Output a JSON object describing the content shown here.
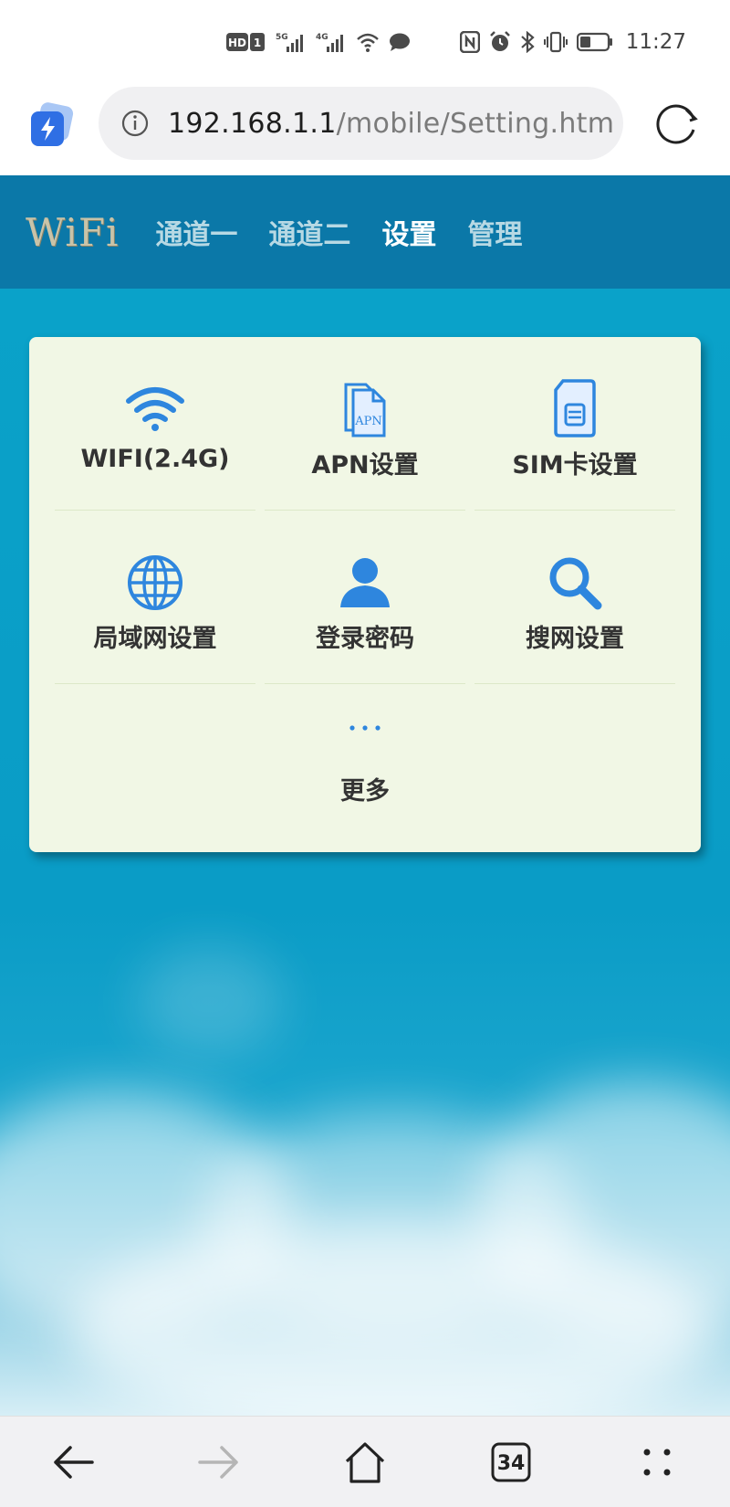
{
  "status_bar": {
    "time": "11:27",
    "icons": [
      "hd-icon",
      "sim1-icon",
      "5g-signal-icon",
      "4g-signal-icon",
      "wifi-icon",
      "message-icon",
      "nfc-icon",
      "alarm-icon",
      "bluetooth-icon",
      "vibrate-icon",
      "battery-icon"
    ],
    "hd_label": "HD",
    "sim_label": "1",
    "net1_label": "5G",
    "net2_label": "4G"
  },
  "browser": {
    "url_host": "192.168.1.1",
    "url_path": "/mobile/Setting.htm",
    "tab_count": "34"
  },
  "site": {
    "logo": "WiFi",
    "nav": [
      {
        "label": "通道一",
        "active": false
      },
      {
        "label": "通道二",
        "active": false
      },
      {
        "label": "设置",
        "active": true
      },
      {
        "label": "管理",
        "active": false
      }
    ]
  },
  "settings": {
    "tiles": [
      {
        "label": "WIFI(2.4G)",
        "icon": "wifi-icon"
      },
      {
        "label": "APN设置",
        "icon": "apn-icon"
      },
      {
        "label": "SIM卡设置",
        "icon": "sim-card-icon"
      },
      {
        "label": "局域网设置",
        "icon": "globe-icon"
      },
      {
        "label": "登录密码",
        "icon": "user-icon"
      },
      {
        "label": "搜网设置",
        "icon": "search-icon"
      }
    ],
    "more_label": "更多"
  },
  "colors": {
    "header_bg": "#0b78a8",
    "content_bg": "#0aa2c9",
    "card_bg": "#f1f7e5",
    "icon_blue": "#2e86de"
  }
}
